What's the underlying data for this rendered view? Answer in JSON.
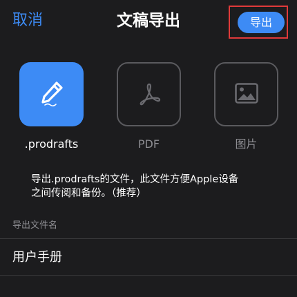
{
  "header": {
    "cancel_label": "取消",
    "title": "文稿导出",
    "export_label": "导出"
  },
  "formats": [
    {
      "label": ".prodrafts",
      "icon": "pencil-icon",
      "selected": true
    },
    {
      "label": "PDF",
      "icon": "pdf-icon",
      "selected": false
    },
    {
      "label": "图片",
      "icon": "image-icon",
      "selected": false
    }
  ],
  "description": {
    "line1": "导出.prodrafts的文件，此文件方便Apple设备",
    "line2": "之间传阅和备份。（推荐）"
  },
  "filename_section": {
    "label": "导出文件名",
    "value": "用户手册"
  },
  "colors": {
    "accent": "#3d8bf5",
    "background": "#1c1c1e",
    "highlight": "#e03a3a",
    "muted": "#8e8e93"
  }
}
